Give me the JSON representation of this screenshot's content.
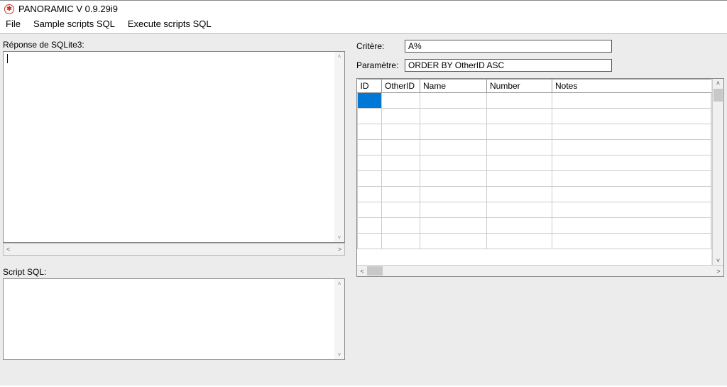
{
  "title": "PANORAMIC V 0.9.29i9",
  "menu": {
    "file": "File",
    "sample": "Sample scripts SQL",
    "execute": "Execute scripts SQL"
  },
  "left": {
    "response_label": "Réponse de SQLite3:",
    "response_value": "",
    "script_label": "Script SQL:",
    "script_value": ""
  },
  "right": {
    "criteria_label": "Critère:",
    "criteria_value": "A%",
    "param_label": "Paramètre:",
    "param_value": "ORDER BY OtherID ASC"
  },
  "grid": {
    "columns": [
      "ID",
      "OtherID",
      "Name",
      "Number",
      "Notes"
    ],
    "rows": [
      [
        "",
        "",
        "",
        "",
        ""
      ],
      [
        "",
        "",
        "",
        "",
        ""
      ],
      [
        "",
        "",
        "",
        "",
        ""
      ],
      [
        "",
        "",
        "",
        "",
        ""
      ],
      [
        "",
        "",
        "",
        "",
        ""
      ],
      [
        "",
        "",
        "",
        "",
        ""
      ],
      [
        "",
        "",
        "",
        "",
        ""
      ],
      [
        "",
        "",
        "",
        "",
        ""
      ],
      [
        "",
        "",
        "",
        "",
        ""
      ],
      [
        "",
        "",
        "",
        "",
        ""
      ]
    ],
    "selected": {
      "row": 0,
      "col": 0
    }
  }
}
